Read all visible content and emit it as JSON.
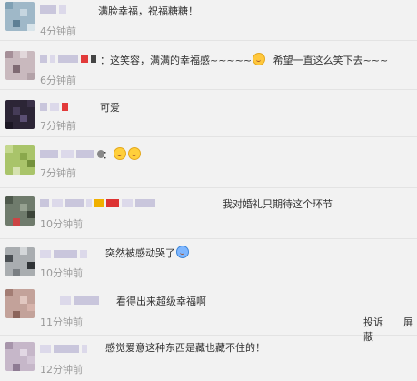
{
  "comments": [
    {
      "text": "满脸幸福，祝福糖糖！",
      "time": "4分钟前"
    },
    {
      "text_a": "：这笑容，满满的幸福感~~~~~",
      "text_b": "希望一直这么笑下去~~~",
      "time": "6分钟前"
    },
    {
      "text": "可爱",
      "time": "7分钟前"
    },
    {
      "text": "：",
      "time": "7分钟前"
    },
    {
      "text": "我对婚礼只期待这个环节",
      "time": "10分钟前"
    },
    {
      "text": "突然被感动哭了",
      "time": "10分钟前"
    },
    {
      "text": "看得出来超级幸福啊",
      "time": "11分钟前"
    },
    {
      "text": "感觉爱意这种东西是藏也藏不住的！",
      "time": "12分钟前"
    }
  ],
  "actions": {
    "report": "投诉",
    "block": "屏蔽"
  },
  "icons": [
    "kiss-emoji-icon",
    "smile-emoji-icon",
    "smile-emoji-icon",
    "laugh-cry-emoji-icon"
  ],
  "colors": {
    "background": "#f2f2f2",
    "text": "#333333",
    "time": "#9a9a9a",
    "divider": "#e3e3e3"
  }
}
